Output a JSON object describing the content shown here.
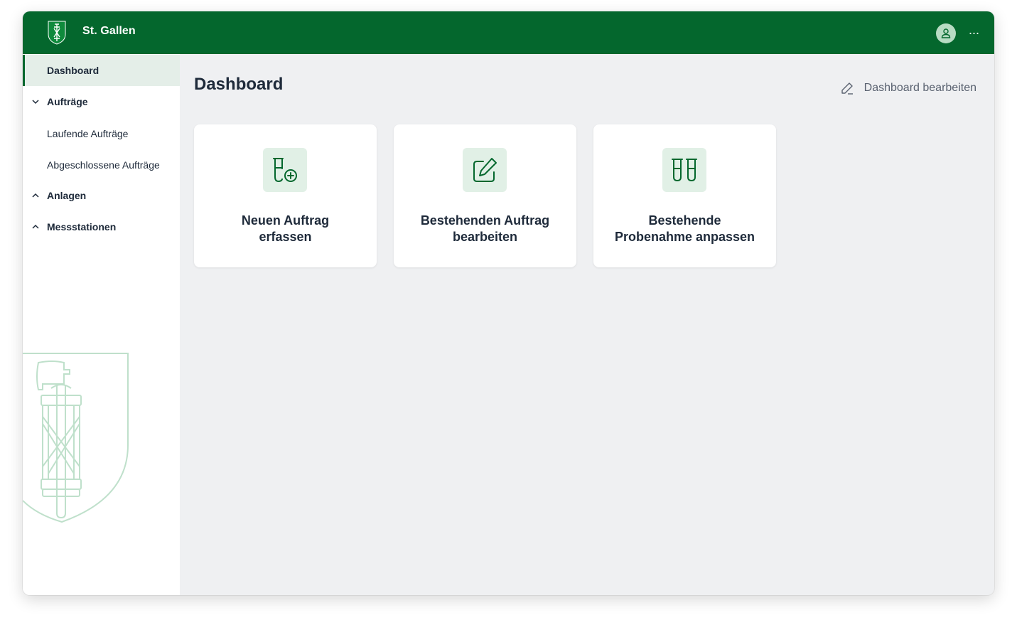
{
  "header": {
    "brand": "St. Gallen",
    "icons": {
      "logo": "st-gallen-coat-of-arms",
      "user": "user-icon",
      "more": "more-icon"
    },
    "more_glyph": "···",
    "colors": {
      "primary": "#04672d",
      "avatar_bg": "#b7dcc3"
    }
  },
  "sidebar": {
    "items": [
      {
        "label": "Dashboard",
        "active": true
      },
      {
        "label": "Aufträge",
        "expanded": true,
        "icon": "chevron-down-icon"
      },
      {
        "label": "Laufende Aufträge"
      },
      {
        "label": "Abgeschlossene Aufträge"
      },
      {
        "label": "Anlagen",
        "expanded": false,
        "icon": "chevron-up-icon"
      },
      {
        "label": "Messstationen",
        "expanded": false,
        "icon": "chevron-up-icon"
      }
    ],
    "watermark": "st-gallen-crest-outline"
  },
  "main": {
    "title": "Dashboard",
    "edit_label": "Dashboard bearbeiten",
    "cards": [
      {
        "line1": "Neuen Auftrag",
        "line2": "erfassen",
        "icon": "test-tube-plus-icon"
      },
      {
        "line1": "Bestehenden Auftrag",
        "line2": "bearbeiten",
        "icon": "edit-icon"
      },
      {
        "line1": "Bestehende",
        "line2": "Probenahme anpassen",
        "icon": "test-tubes-icon"
      }
    ]
  }
}
